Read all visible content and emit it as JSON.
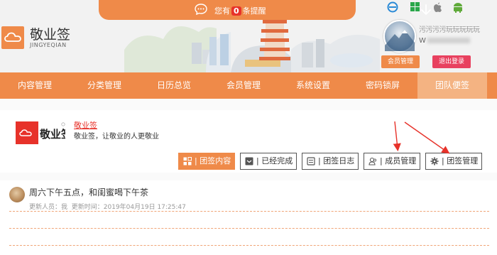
{
  "notification": {
    "prefix": "您有",
    "count": "0",
    "suffix": "条提醒"
  },
  "brand": {
    "title": "敬业签",
    "subtitle": "JINGYEQIAN"
  },
  "user": {
    "name": "污污污污玩玩玩玩玩",
    "id_prefix": "W",
    "member_button": "会员管理",
    "logout_button": "退出登录"
  },
  "nav": {
    "items": [
      {
        "label": "内容管理"
      },
      {
        "label": "分类管理"
      },
      {
        "label": "日历总览"
      },
      {
        "label": "会员管理"
      },
      {
        "label": "系统设置"
      },
      {
        "label": "密码锁屏"
      },
      {
        "label": "团队便签"
      }
    ],
    "active_index": 6
  },
  "team": {
    "logo_text": "敬业签",
    "name": "敬业签",
    "description": "敬业签，让敬业的人更敬业"
  },
  "actions": {
    "team_content": "| 团签内容",
    "completed": "| 已经完成",
    "team_log": "| 团签日志",
    "members": "| 成员管理",
    "team_manage": "| 团签管理"
  },
  "post": {
    "title": "周六下午五点，和闺蜜喝下午茶",
    "updater_label": "更新人员：",
    "updater": "我",
    "time_label": "更新时间：",
    "time": "2019年04月19日 17:25:47"
  },
  "colors": {
    "accent": "#ef8a49",
    "nav_active": "#f4b382",
    "logout": "#e8415f",
    "alert": "#e7322a"
  }
}
